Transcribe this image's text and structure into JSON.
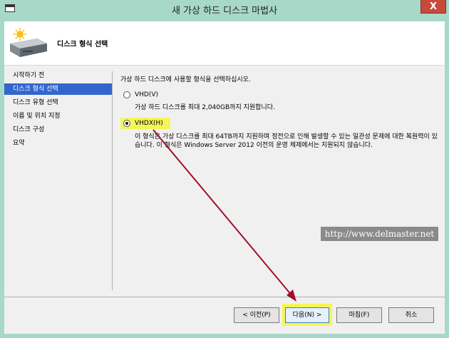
{
  "window": {
    "title": "새 가상 하드 디스크 마법사",
    "close_label": "X"
  },
  "header": {
    "title": "디스크 형식 선택"
  },
  "nav": {
    "items": [
      {
        "label": "시작하기 전"
      },
      {
        "label": "디스크 형식 선택"
      },
      {
        "label": "디스크 유형 선택"
      },
      {
        "label": "이름 및 위치 지정"
      },
      {
        "label": "디스크 구성"
      },
      {
        "label": "요약"
      }
    ],
    "active_index": 1
  },
  "content": {
    "intro": "가상 하드 디스크에 사용할 형식을 선택하십시오.",
    "options": [
      {
        "label": "VHD(V)",
        "description": "가상 하드 디스크를 최대 2,040GB까지 지원합니다.",
        "selected": false
      },
      {
        "label": "VHDX(H)",
        "description": "이 형식은 가상 디스크를 최대 64TB까지 지원하며 정전으로 인해 발생할 수 있는 일관성 문제에 대한 복원력이 있습니다. 이 형식은 Windows Server 2012 이전의 운영 체제에서는 지원되지 않습니다.",
        "selected": true
      }
    ]
  },
  "watermark": "http://www.delmaster.net",
  "buttons": {
    "previous": "< 이전(P)",
    "next": "다음(N) >",
    "finish": "마침(F)",
    "cancel": "취소"
  },
  "colors": {
    "nav_active": "#3366cc",
    "highlight": "#f5f55a",
    "annotation_arrow": "#a0102a",
    "titlebar": "#a8d8c8"
  }
}
